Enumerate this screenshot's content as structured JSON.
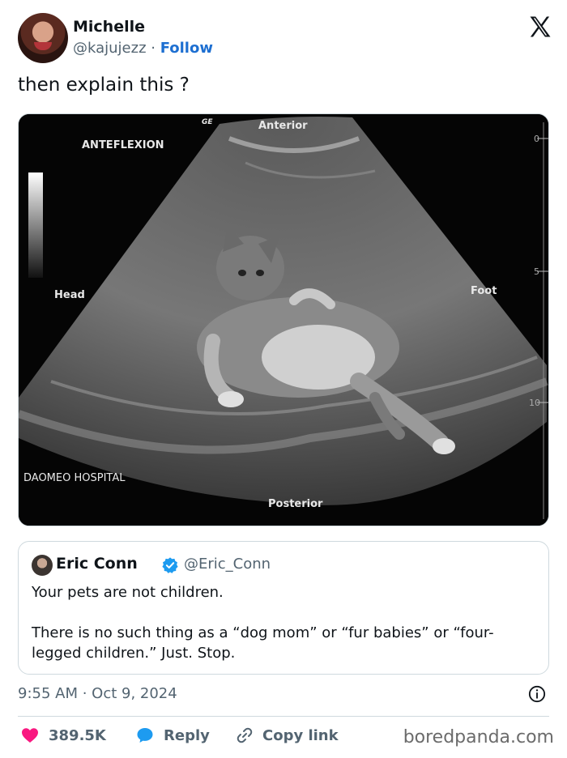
{
  "author": {
    "name": "Michelle",
    "handle": "@kajujezz",
    "separator": " · ",
    "follow_label": "Follow"
  },
  "tweet": {
    "text": "then explain this ?"
  },
  "media": {
    "labels": {
      "ge": "GE",
      "anterior": "Anterior",
      "anteflexion": "ANTEFLEXION",
      "head": "Head",
      "foot": "Foot",
      "hospital": "DAOMEO HOSPITAL",
      "posterior": "Posterior",
      "scale_0": "0",
      "scale_5": "5",
      "scale_10": "10"
    }
  },
  "quote": {
    "name": "Eric Conn",
    "handle": "@Eric_Conn",
    "line1": "Your pets are not children.",
    "line2": "There is no such thing as a “dog mom” or “fur babies” or “four-legged children.” Just. Stop."
  },
  "meta": {
    "timestamp": "9:55 AM · Oct 9, 2024"
  },
  "actions": {
    "likes": "389.5K",
    "reply_label": "Reply",
    "copy_label": "Copy link"
  },
  "watermark": "boredpanda.com",
  "colors": {
    "follow": "#1d6fd1",
    "like": "#f91880",
    "reply": "#1d9bf0",
    "verified": "#1d9bf0"
  }
}
